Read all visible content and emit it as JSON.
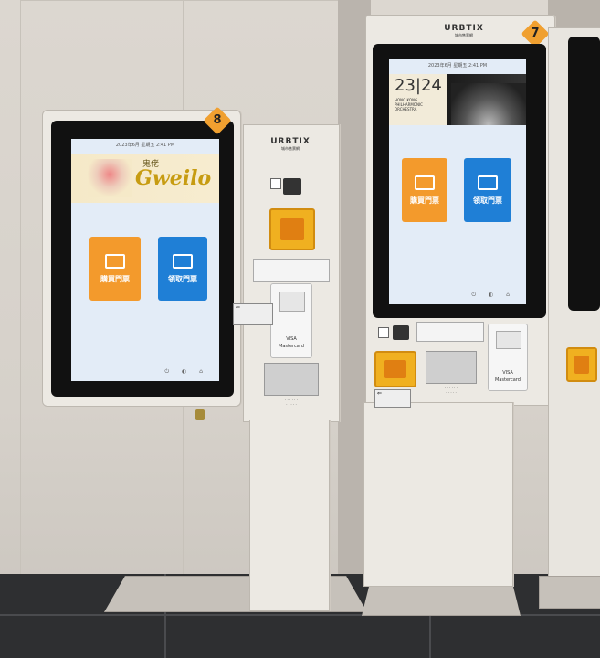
{
  "kiosks": {
    "left": {
      "badge_number": "8",
      "status_bar": "2023年6月  星期五  2:41 PM",
      "banner_title": "Gweilo",
      "banner_subtitle": "鬼佬",
      "buttons": [
        {
          "label": "購買門票",
          "color": "#f39a2c",
          "icon": "ticket-icon"
        },
        {
          "label": "領取門票",
          "color": "#1f7fd6",
          "icon": "print-icon"
        }
      ]
    },
    "right": {
      "badge_number": "7",
      "status_bar": "2023年6月  星期五  2:41 PM",
      "banner_title": "23|24",
      "banner_subtitle": "HONG KONG PHILHARMONIC ORCHESTRA",
      "buttons": [
        {
          "label": "購買門票",
          "color": "#f39a2c",
          "icon": "ticket-icon"
        },
        {
          "label": "領取門票",
          "color": "#1f7fd6",
          "icon": "print-icon"
        }
      ]
    }
  },
  "branding": {
    "name": "URBTIX",
    "subtitle": "城市售票網"
  },
  "payment": {
    "brands": [
      "VISA",
      "Mastercard"
    ]
  }
}
